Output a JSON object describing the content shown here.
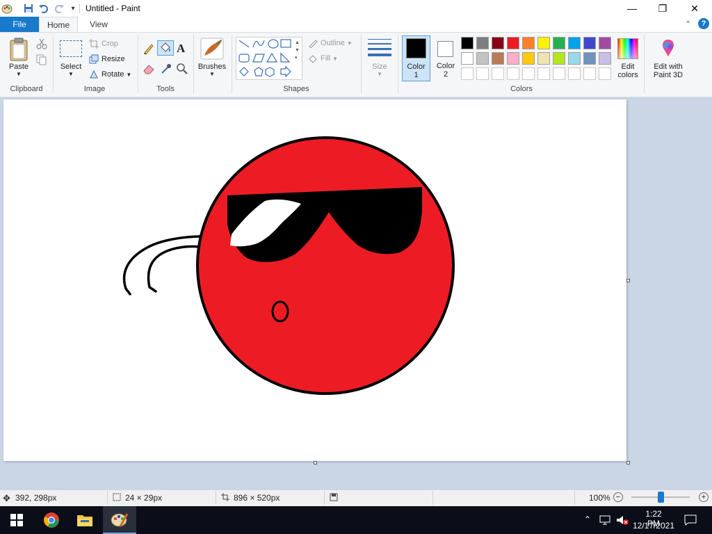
{
  "window": {
    "title": "Untitled - Paint",
    "controls": {
      "minimize": "—",
      "maximize": "❐",
      "close": "✕"
    }
  },
  "quick_access": {
    "save": "save-icon",
    "undo": "undo-icon",
    "redo": "redo-icon",
    "customize": "▾"
  },
  "tabs": {
    "file": "File",
    "home": "Home",
    "view": "View"
  },
  "ribbon": {
    "clipboard": {
      "label": "Clipboard",
      "paste": "Paste"
    },
    "image": {
      "label": "Image",
      "select": "Select",
      "crop": "Crop",
      "resize": "Resize",
      "rotate": "Rotate"
    },
    "tools": {
      "label": "Tools"
    },
    "brushes": {
      "label": "Brushes"
    },
    "shapes": {
      "label": "Shapes",
      "outline": "Outline",
      "fill": "Fill"
    },
    "size": {
      "label": "Size"
    },
    "colors": {
      "label": "Colors",
      "color1": "Color\n1",
      "color1_a": "Color",
      "color1_b": "1",
      "color2_a": "Color",
      "color2_b": "2",
      "edit_colors_a": "Edit",
      "edit_colors_b": "colors",
      "paint3d_a": "Edit with",
      "paint3d_b": "Paint 3D",
      "color1_value": "#000000",
      "color2_value": "#ffffff",
      "palette_row1": [
        "#000000",
        "#7f7f7f",
        "#880015",
        "#ed1c24",
        "#ff7f27",
        "#fff200",
        "#22b14c",
        "#00a2e8",
        "#3f48cc",
        "#a349a4"
      ],
      "palette_row2": [
        "#ffffff",
        "#c3c3c3",
        "#b97a57",
        "#ffaec9",
        "#ffc90e",
        "#efe4b0",
        "#b5e61d",
        "#99d9ea",
        "#7092be",
        "#c8bfe7"
      ]
    }
  },
  "drawing": {
    "ball_color": "#ed1c24",
    "outline_color": "#000000"
  },
  "status": {
    "cursor_pos": "392, 298px",
    "selection_size": "24 × 29px",
    "canvas_size": "896 × 520px",
    "zoom": "100%"
  },
  "taskbar": {
    "time": "1:22 PM",
    "date": "12/17/2021"
  }
}
